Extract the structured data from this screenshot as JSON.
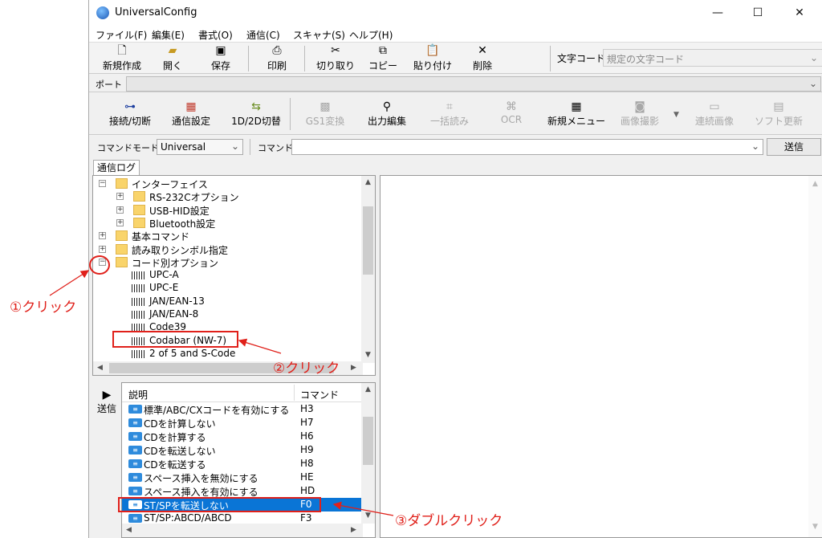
{
  "window": {
    "title": "UniversalConfig",
    "controls": [
      "—",
      "☐",
      "✕"
    ]
  },
  "menu": [
    "ファイル(F)",
    "編集(E)",
    "書式(O)",
    "通信(C)",
    "スキャナ(S)",
    "ヘルプ(H)"
  ],
  "toolbar1": {
    "new": "新規作成",
    "open": "開く",
    "save": "保存",
    "print": "印刷",
    "cut": "切り取り",
    "copy": "コピー",
    "paste": "貼り付け",
    "delete": "削除",
    "charcode_label": "文字コード",
    "charcode_value": "規定の文字コード"
  },
  "portbar": {
    "label": "ポート"
  },
  "toolbar2": {
    "connect": "接続/切断",
    "comm_settings": "通信設定",
    "code_switch": "1D/2D切替",
    "gs1": "GS1変換",
    "output_edit": "出力編集",
    "batch_read": "一括読み",
    "ocr": "OCR",
    "new_menu": "新規メニュー",
    "capture": "画像撮影",
    "continuous": "連続画像",
    "firmware": "ソフト更新"
  },
  "cmdbar": {
    "mode_label": "コマンドモード",
    "mode_value": "Universal",
    "cmd_label": "コマンド",
    "send": "送信"
  },
  "log_tab": "通信ログ",
  "tree": [
    {
      "label": "インターフェイス",
      "level": 0,
      "kind": "folder",
      "expander": "−"
    },
    {
      "label": "RS-232Cオプション",
      "level": 1,
      "kind": "folder",
      "expander": "+"
    },
    {
      "label": "USB-HID設定",
      "level": 1,
      "kind": "folder",
      "expander": "+"
    },
    {
      "label": "Bluetooth設定",
      "level": 1,
      "kind": "folder",
      "expander": "+"
    },
    {
      "label": "基本コマンド",
      "level": 0,
      "kind": "folder",
      "expander": "+"
    },
    {
      "label": "読み取りシンボル指定",
      "level": 0,
      "kind": "folder",
      "expander": "+"
    },
    {
      "label": "コード別オプション",
      "level": 0,
      "kind": "folder",
      "expander": "−"
    },
    {
      "label": "UPC-A",
      "level": 1,
      "kind": "barcode"
    },
    {
      "label": "UPC-E",
      "level": 1,
      "kind": "barcode"
    },
    {
      "label": "JAN/EAN-13",
      "level": 1,
      "kind": "barcode"
    },
    {
      "label": "JAN/EAN-8",
      "level": 1,
      "kind": "barcode"
    },
    {
      "label": "Code39",
      "level": 1,
      "kind": "barcode"
    },
    {
      "label": "Codabar (NW-7)",
      "level": 1,
      "kind": "barcode"
    },
    {
      "label": "2 of 5 and S-Code",
      "level": 1,
      "kind": "barcode"
    }
  ],
  "send_side": "送信",
  "cmd_table": {
    "headers": [
      "説明",
      "コマンド"
    ],
    "rows": [
      {
        "desc": "標準/ABC/CXコードを有効にする",
        "cmd": "H3"
      },
      {
        "desc": "CDを計算しない",
        "cmd": "H7"
      },
      {
        "desc": "CDを計算する",
        "cmd": "H6"
      },
      {
        "desc": "CDを転送しない",
        "cmd": "H9"
      },
      {
        "desc": "CDを転送する",
        "cmd": "H8"
      },
      {
        "desc": "スペース挿入を無効にする",
        "cmd": "HE"
      },
      {
        "desc": "スペース挿入を有効にする",
        "cmd": "HD"
      },
      {
        "desc": "ST/SPを転送しない",
        "cmd": "F0",
        "selected": true
      },
      {
        "desc": "ST/SP:ABCD/ABCD",
        "cmd": "F3"
      }
    ]
  },
  "annotations": {
    "step1": "①クリック",
    "step2": "②クリック",
    "step3": "③ダブルクリック"
  },
  "colors": {
    "annotation": "#e0201a",
    "selection": "#0a75d6",
    "folder": "#f9d46b"
  }
}
